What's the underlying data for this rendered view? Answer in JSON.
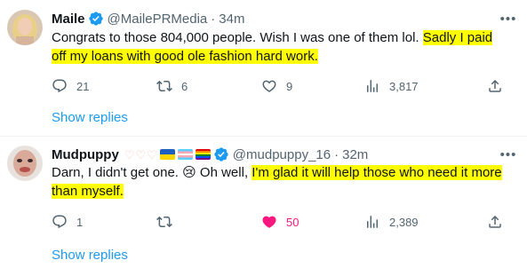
{
  "tweets": [
    {
      "name": "Maile",
      "handle": "@MailePRMedia",
      "separator": "·",
      "time": "34m",
      "text_plain": "Congrats to those 804,000 people. Wish I was one of them lol. ",
      "text_highlight": "Sadly I paid off my loans with good ole fashion hard work.",
      "reply_count": "21",
      "retweet_count": "6",
      "like_count": "9",
      "view_count": "3,817",
      "show_replies": "Show replies"
    },
    {
      "name": "Mudpuppy",
      "handle": "@mudpuppy_16",
      "separator": "·",
      "time": "32m",
      "text_plain": "Darn, I didn't get one. 😢 Oh well, ",
      "text_highlight": "I'm glad it will help those who need it more than myself.",
      "reply_count": "1",
      "retweet_count": "",
      "like_count": "50",
      "view_count": "2,389",
      "show_replies": "Show replies"
    }
  ],
  "icons": {
    "reply": "reply-icon",
    "retweet": "retweet-icon",
    "like": "heart-icon",
    "views": "views-icon",
    "share": "share-icon",
    "more": "more-icon",
    "verified": "verified-badge-icon"
  },
  "colors": {
    "accent": "#1d9bf0",
    "secondary_text": "#536471",
    "highlight": "#ffff00",
    "like_active": "#f91880"
  }
}
